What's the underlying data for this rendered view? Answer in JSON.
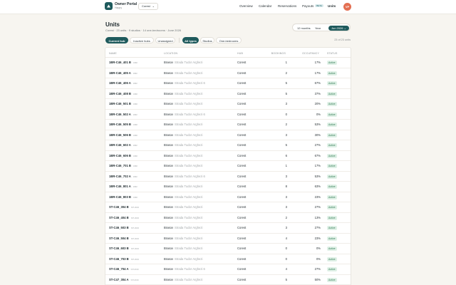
{
  "header": {
    "brand_name": "Owner Portal",
    "brand_sub": "Happy",
    "owner_select": "Corest",
    "nav": [
      {
        "label": "Overview"
      },
      {
        "label": "Calendar"
      },
      {
        "label": "Reservations"
      },
      {
        "label": "Payouts",
        "badge": "BETA"
      },
      {
        "label": "Units"
      }
    ],
    "avatar_initials": "VP"
  },
  "page": {
    "title": "Units",
    "subtitle": "Corest · 23 units · 9 studios · 14 one-bedrooms · June 2026"
  },
  "range": {
    "options": [
      "12 months",
      "Year",
      "Jun 2026"
    ],
    "selected": "Jun 2026"
  },
  "filters": {
    "group1": [
      "Current hub",
      "Inactive hubs",
      "Unassigned"
    ],
    "group2": [
      "All types",
      "Studios",
      "One-bedrooms"
    ],
    "selected_group1": "Current hub",
    "selected_group2": "All types",
    "count_label": "23 of 23 units"
  },
  "table": {
    "columns": [
      "Name",
      "Location",
      "Hub",
      "Bookings",
      "Occupancy",
      "Status"
    ],
    "rows": [
      {
        "name": "1BR-C46_401 B",
        "tag": "1BR",
        "city": "Brasov",
        "street": "Strada Tudor Arghezi",
        "hub": "Corest",
        "bookings": "1",
        "occupancy": "17%",
        "status": "Active"
      },
      {
        "name": "1BR-C46_405 A",
        "tag": "1BR",
        "city": "Brasov",
        "street": "Strada Tudor Arghezi",
        "hub": "Corest",
        "bookings": "2",
        "occupancy": "17%",
        "status": "Active"
      },
      {
        "name": "1BR-C46_406 A",
        "tag": "1BR",
        "city": "Brasov",
        "street": "Strada Tudor Arghezi 6",
        "hub": "Corest",
        "bookings": "5",
        "occupancy": "67%",
        "status": "Active"
      },
      {
        "name": "1BR-C46_408 B",
        "tag": "1BR",
        "city": "Brasov",
        "street": "Strada Tudor Arghezi",
        "hub": "Corest",
        "bookings": "5",
        "occupancy": "37%",
        "status": "Active"
      },
      {
        "name": "1BR-C46_501 B",
        "tag": "1BR",
        "city": "Brasov",
        "street": "Strada Tudor Arghezi",
        "hub": "Corest",
        "bookings": "3",
        "occupancy": "20%",
        "status": "Active"
      },
      {
        "name": "1BR-C46_502 A",
        "tag": "1BR",
        "city": "Brasov",
        "street": "Strada Tudor Arghezi 6",
        "hub": "Corest",
        "bookings": "0",
        "occupancy": "0%",
        "status": "Active"
      },
      {
        "name": "1BR-C46_505 B",
        "tag": "1BR",
        "city": "Brasov",
        "street": "Strada Tudor Arghezi",
        "hub": "Corest",
        "bookings": "2",
        "occupancy": "53%",
        "status": "Active"
      },
      {
        "name": "1BR-C46_506 B",
        "tag": "1BR",
        "city": "Brasov",
        "street": "Strada Tudor Arghezi",
        "hub": "Corest",
        "bookings": "3",
        "occupancy": "30%",
        "status": "Active"
      },
      {
        "name": "1BR-C46_602 A",
        "tag": "1BR",
        "city": "Brasov",
        "street": "Strada Tudor Arghezi",
        "hub": "Corest",
        "bookings": "5",
        "occupancy": "27%",
        "status": "Active"
      },
      {
        "name": "1BR-C46_606 B",
        "tag": "1BR",
        "city": "Brasov",
        "street": "Strada Tudor Arghezi",
        "hub": "Corest",
        "bookings": "6",
        "occupancy": "67%",
        "status": "Active"
      },
      {
        "name": "1BR-C46_701 B",
        "tag": "1BR",
        "city": "Brasov",
        "street": "Strada Tudor Arghezi",
        "hub": "Corest",
        "bookings": "1",
        "occupancy": "17%",
        "status": "Active"
      },
      {
        "name": "1BR-C46_702 A",
        "tag": "1BR",
        "city": "Brasov",
        "street": "Strada Tudor Arghezi 6",
        "hub": "Corest",
        "bookings": "3",
        "occupancy": "53%",
        "status": "Active"
      },
      {
        "name": "1BR-C46_801 A",
        "tag": "1BR",
        "city": "Brasov",
        "street": "Strada Tudor Arghezi",
        "hub": "Corest",
        "bookings": "8",
        "occupancy": "63%",
        "status": "Active"
      },
      {
        "name": "1BR-C46_803 B",
        "tag": "1BR",
        "city": "Brasov",
        "street": "Strada Tudor Arghezi",
        "hub": "Corest",
        "bookings": "3",
        "occupancy": "23%",
        "status": "Active"
      },
      {
        "name": "ST-C46_304 B",
        "tag": "STUDIO",
        "city": "Brasov",
        "street": "Strada Tudor Arghezi",
        "hub": "Corest",
        "bookings": "3",
        "occupancy": "27%",
        "status": "Active"
      },
      {
        "name": "ST-C46_404 B",
        "tag": "STUDIO",
        "city": "Brasov",
        "street": "Strada Tudor Arghezi",
        "hub": "Corest",
        "bookings": "2",
        "occupancy": "13%",
        "status": "Active"
      },
      {
        "name": "ST-C46_503 B",
        "tag": "STUDIO",
        "city": "Brasov",
        "street": "Strada Tudor Arghezi",
        "hub": "Corest",
        "bookings": "3",
        "occupancy": "27%",
        "status": "Active"
      },
      {
        "name": "ST-C46_504 B",
        "tag": "STUDIO",
        "city": "Brasov",
        "street": "Strada Tudor Arghezi",
        "hub": "Corest",
        "bookings": "4",
        "occupancy": "23%",
        "status": "Active"
      },
      {
        "name": "ST-C46_603 B",
        "tag": "STUDIO",
        "city": "Brasov",
        "street": "Strada Tudor Arghezi",
        "hub": "Corest",
        "bookings": "0",
        "occupancy": "0%",
        "status": "Active"
      },
      {
        "name": "ST-C46_703 B",
        "tag": "STUDIO",
        "city": "Brasov",
        "street": "Strada Tudor Arghezi",
        "hub": "Corest",
        "bookings": "0",
        "occupancy": "0%",
        "status": "Active"
      },
      {
        "name": "ST-C46_704 A",
        "tag": "STUDIO",
        "city": "Brasov",
        "street": "Strada Tudor Arghezi 6",
        "hub": "Corest",
        "bookings": "4",
        "occupancy": "27%",
        "status": "Active"
      },
      {
        "name": "ST-C47_304 A",
        "tag": "STUDIO",
        "city": "Brasov",
        "street": "Strada Tudor Arghezi",
        "hub": "Corest",
        "bookings": "5",
        "occupancy": "50%",
        "status": "Active"
      }
    ]
  },
  "colors": {
    "brand": "#1e5a5c",
    "avatar": "#e36f52",
    "status_active_bg": "#dff0e6",
    "status_active_text": "#2f7a52"
  }
}
